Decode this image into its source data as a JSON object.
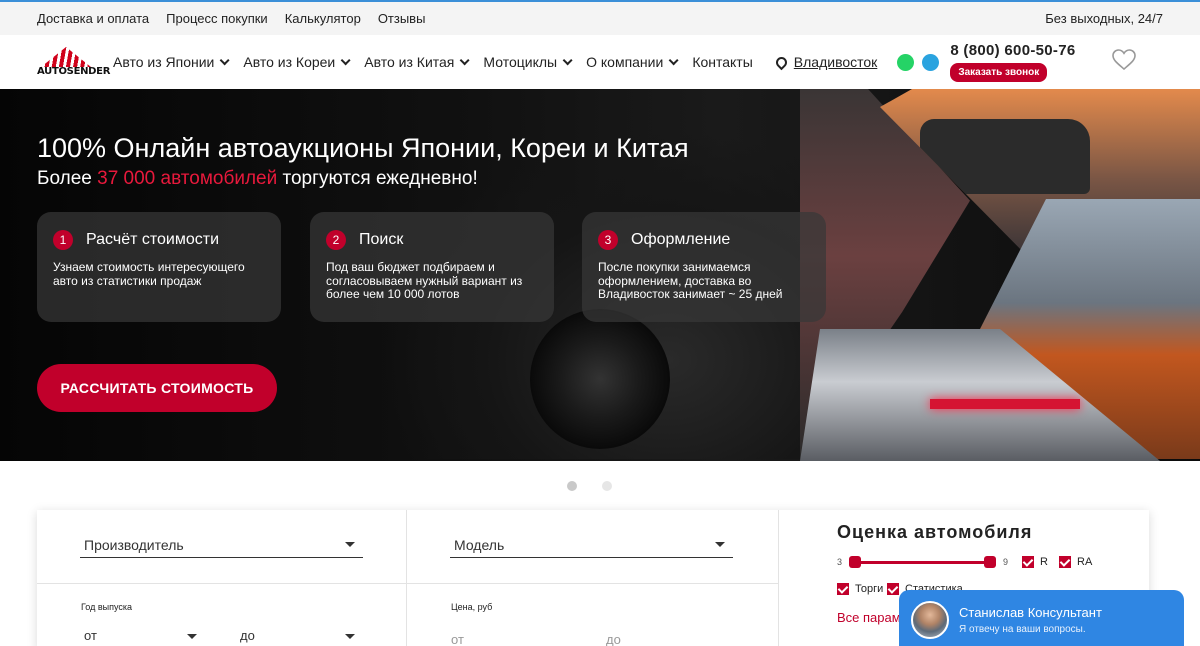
{
  "topbar": {
    "links": [
      "Доставка и оплата",
      "Процесс покупки",
      "Калькулятор",
      "Отзывы"
    ],
    "schedule": "Без выходных, 24/7"
  },
  "header": {
    "logo_text": "AUTOSENDER",
    "nav": [
      "Авто из Японии",
      "Авто из Кореи",
      "Авто из Китая",
      "Мотоциклы",
      "О компании"
    ],
    "contacts": "Контакты",
    "city": "Владивосток",
    "phone": "8 (800) 600-50-76",
    "callback_label": "Заказать звонок"
  },
  "hero": {
    "title": "100% Онлайн автоаукционы Японии, Кореи и Китая",
    "subtitle_before": "Более ",
    "subtitle_accent": "37 000 автомобилей",
    "subtitle_after": " торгуются ежедневно!",
    "cards": [
      {
        "num": "1",
        "title": "Расчёт стоимости",
        "text": "Узнаем стоимость интересующего авто из статистики продаж"
      },
      {
        "num": "2",
        "title": "Поиск",
        "text": "Под ваш бюджет подбираем и согласовываем нужный вариант из более чем 10 000 лотов"
      },
      {
        "num": "3",
        "title": "Оформление",
        "text": "После покупки занимаемся оформлением, доставка во Владивосток занимает ~ 25 дней"
      }
    ],
    "cta_label": "РАССЧИТАТЬ СТОИМОСТЬ"
  },
  "slider": {
    "active_index": 0,
    "count": 2
  },
  "filter": {
    "manufacturer": "Производитель",
    "model": "Модель",
    "year_label": "Год выпуска",
    "year_from": "от",
    "year_to": "до",
    "price_label": "Цена, руб",
    "price_from": "от",
    "price_to": "до"
  },
  "estimate": {
    "title": "Оценка автомобиля",
    "range_min": "3",
    "range_max": "9",
    "checks": [
      "R",
      "RA",
      "Торги",
      "Статистика"
    ],
    "all_params": "Все параметры"
  },
  "chat": {
    "name": "Станислав Консультант",
    "message": "Я отвечу на ваши вопросы."
  },
  "colors": {
    "accent": "#c1002b",
    "chat": "#2f86e3"
  }
}
